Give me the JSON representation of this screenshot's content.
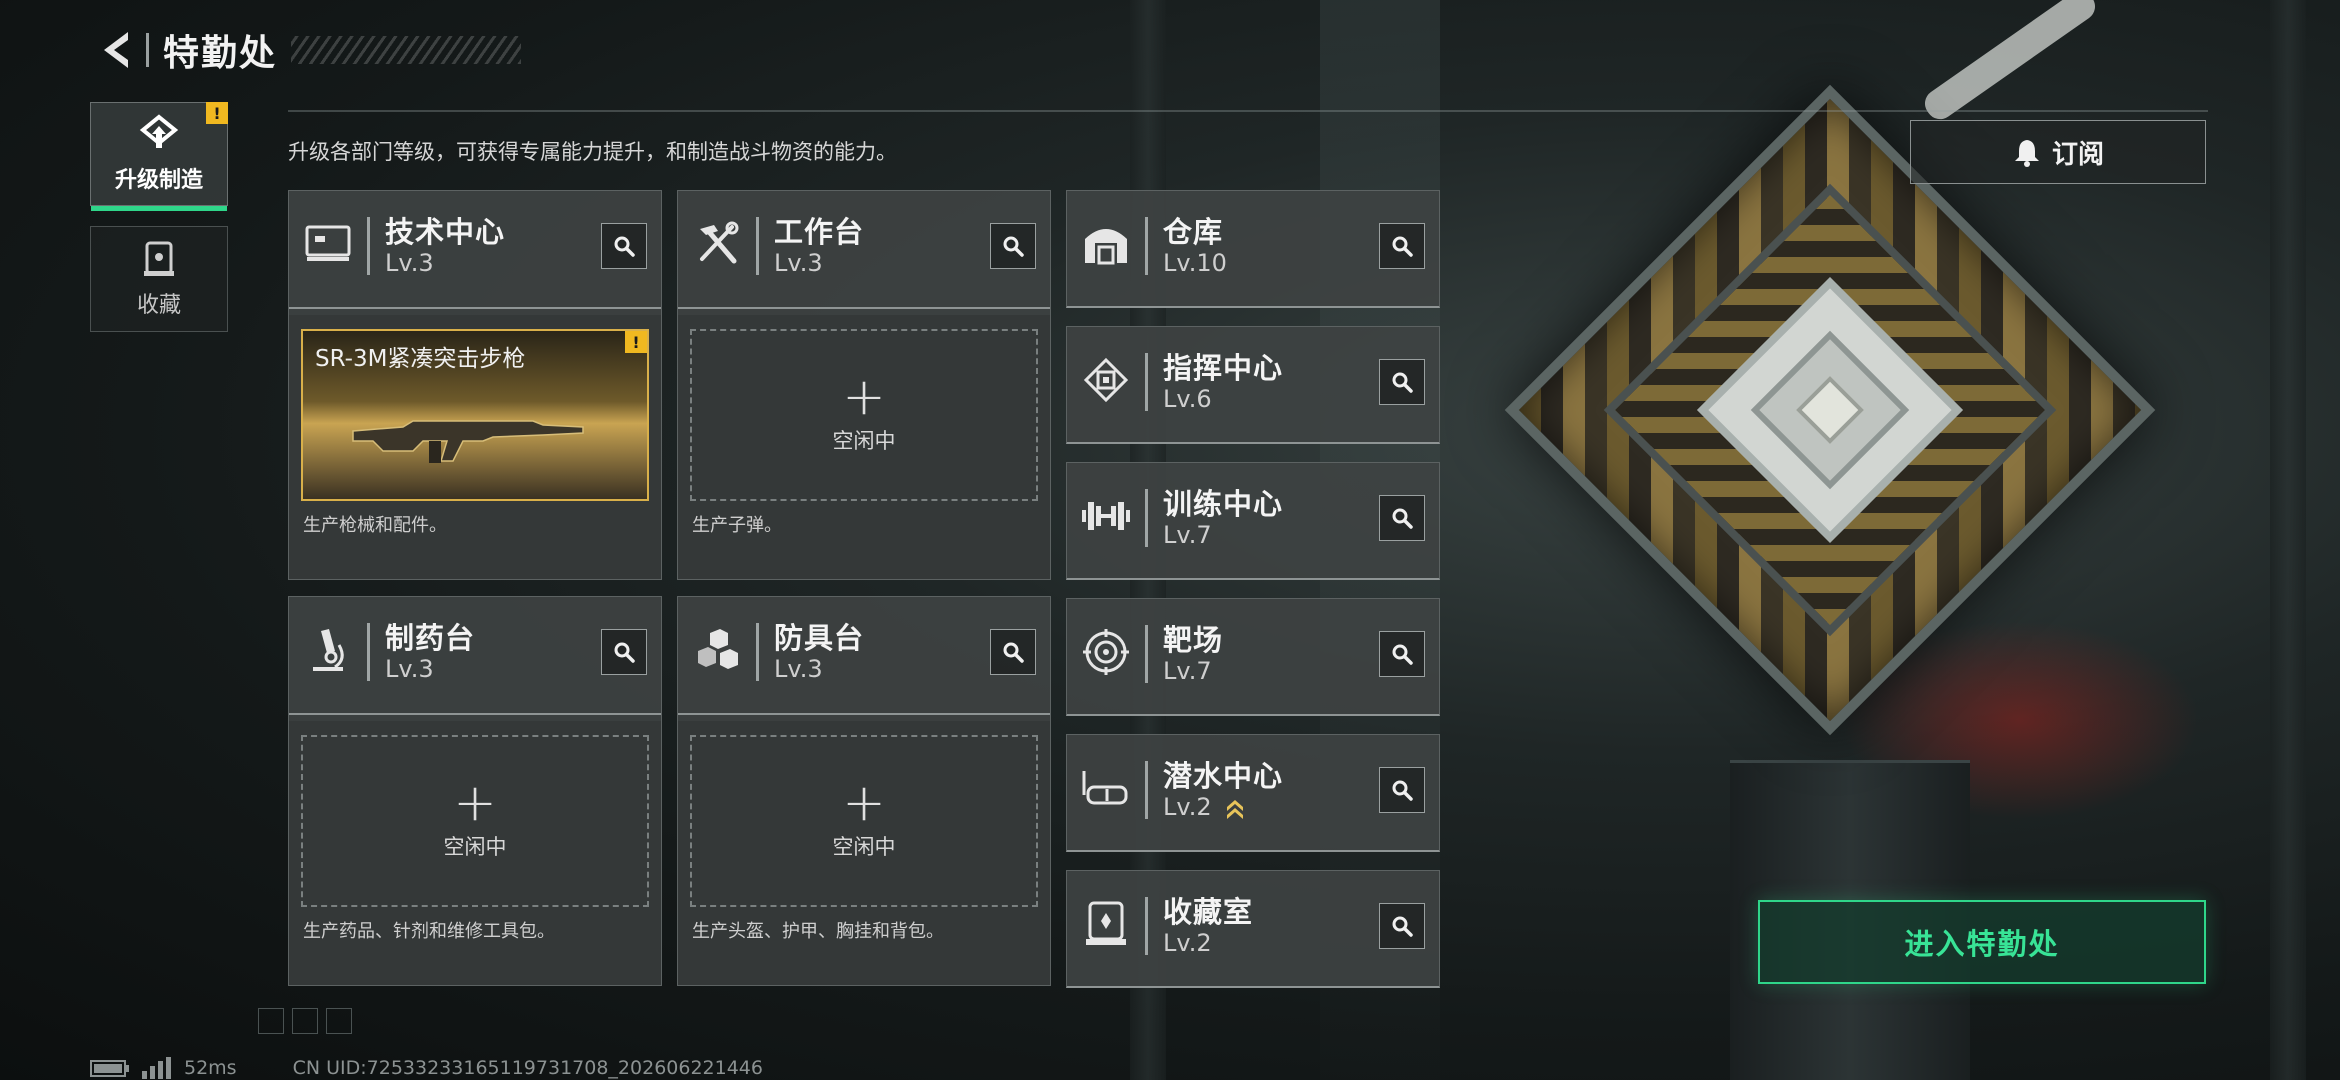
{
  "header": {
    "title": "特勤处"
  },
  "nav": {
    "items": [
      {
        "label": "升级制造",
        "active": true,
        "alert": "!"
      },
      {
        "label": "收藏",
        "active": false
      }
    ]
  },
  "description": "升级各部门等级，可获得专属能力提升，和制造战斗物资的能力。",
  "production_cards": [
    {
      "name": "技术中心",
      "level": "Lv.3",
      "icon": "monitor-icon",
      "note": "生产枪械和配件。",
      "slot": {
        "type": "item",
        "item_name": "SR-3M紧凑突击步枪",
        "alert": "!"
      }
    },
    {
      "name": "工作台",
      "level": "Lv.3",
      "icon": "tools-icon",
      "note": "生产子弹。",
      "slot": {
        "type": "empty",
        "plus": "+",
        "text": "空闲中"
      }
    },
    {
      "name": "制药台",
      "level": "Lv.3",
      "icon": "microscope-icon",
      "note": "生产药品、针剂和维修工具包。",
      "slot": {
        "type": "empty",
        "plus": "+",
        "text": "空闲中"
      }
    },
    {
      "name": "防具台",
      "level": "Lv.3",
      "icon": "armor-boxes-icon",
      "note": "生产头盔、护甲、胸挂和背包。",
      "slot": {
        "type": "empty",
        "plus": "+",
        "text": "空闲中"
      }
    }
  ],
  "facilities": [
    {
      "name": "仓库",
      "level": "Lv.10",
      "icon": "warehouse-icon"
    },
    {
      "name": "指挥中心",
      "level": "Lv.6",
      "icon": "chip-icon"
    },
    {
      "name": "训练中心",
      "level": "Lv.7",
      "icon": "dumbbell-icon"
    },
    {
      "name": "靶场",
      "level": "Lv.7",
      "icon": "target-icon"
    },
    {
      "name": "潜水中心",
      "level": "Lv.2",
      "icon": "diving-mask-icon",
      "upgrade_available": true
    },
    {
      "name": "收藏室",
      "level": "Lv.2",
      "icon": "display-case-icon"
    }
  ],
  "actions": {
    "subscribe_label": "订阅",
    "enter_label": "进入特勤处"
  },
  "status": {
    "ping": "52ms",
    "uid": "CN UID:7253323316511973170​8_202606221446"
  },
  "colors": {
    "accent": "#2fd68a",
    "alert": "#f0b820",
    "card_bg": "#3e4242"
  }
}
